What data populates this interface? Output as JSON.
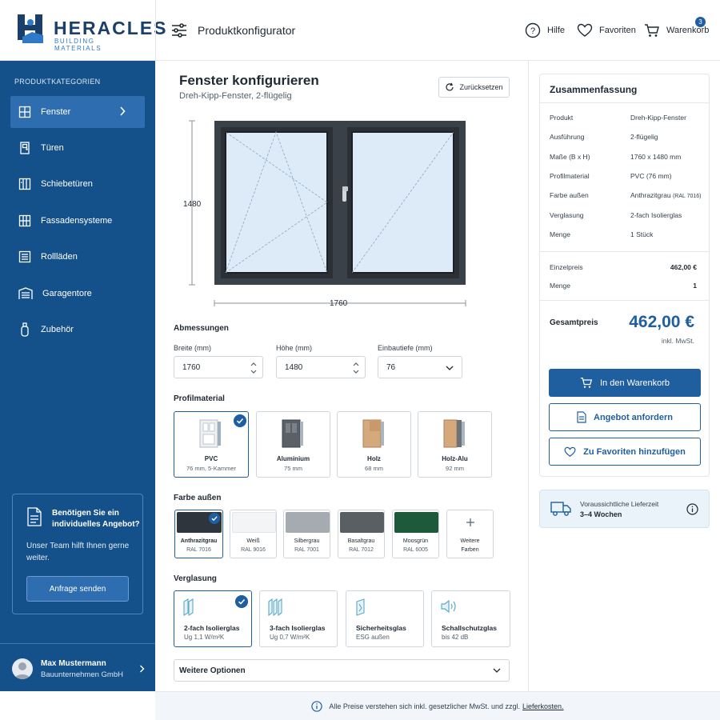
{
  "brand": {
    "name": "HERACLES",
    "tagline": "BUILDING MATERIALS",
    "accent": "#1f5fa0",
    "sidebar_bg": "#14508a"
  },
  "header": {
    "title": "Produktkonfigurator",
    "help": "Hilfe",
    "favorites": "Favoriten",
    "cart": "Warenkorb",
    "cart_count": "3"
  },
  "sidebar": {
    "heading": "PRODUKTKATEGORIEN",
    "items": [
      {
        "label": "Fenster",
        "icon": "window-icon",
        "active": true
      },
      {
        "label": "Türen",
        "icon": "door-icon"
      },
      {
        "label": "Schiebetüren",
        "icon": "sliding-door-icon"
      },
      {
        "label": "Fassadensysteme",
        "icon": "facade-icon"
      },
      {
        "label": "Rollläden",
        "icon": "shutter-icon"
      },
      {
        "label": "Garagentore",
        "icon": "garage-icon"
      },
      {
        "label": "Zubehör",
        "icon": "accessory-icon"
      }
    ],
    "help": {
      "title": "Benötigen Sie ein individuelles Angebot?",
      "text": "Unser Team hilft Ihnen gerne weiter.",
      "button": "Anfrage senden"
    },
    "user": {
      "name": "Max Mustermann",
      "company": "Bauunternehmen GmbH"
    }
  },
  "main": {
    "title": "Fenster konfigurieren",
    "subtitle": "Dreh-Kipp-Fenster, 2-flügelig",
    "reset": "Zurücksetzen",
    "preview": {
      "height_label": "1480",
      "width_label": "1760",
      "frame_color": "#3b4148",
      "glass_color": "#dcebf7"
    },
    "dimensions": {
      "title": "Abmessungen",
      "width_label": "Breite (mm)",
      "width_value": "1760",
      "height_label": "Höhe (mm)",
      "height_value": "1480",
      "depth_label": "Einbautiefe (mm)",
      "depth_value": "76"
    },
    "profile": {
      "title": "Profilmaterial",
      "options": [
        {
          "name": "PVC",
          "detail": "76 mm, 5-Kammer",
          "selected": true
        },
        {
          "name": "Aluminium",
          "detail": "75 mm"
        },
        {
          "name": "Holz",
          "detail": "68 mm"
        },
        {
          "name": "Holz-Alu",
          "detail": "92 mm"
        }
      ]
    },
    "color": {
      "title": "Farbe außen",
      "options": [
        {
          "name": "Anthrazitgrau",
          "code": "RAL 7016",
          "hex": "#2e353d",
          "selected": true
        },
        {
          "name": "Weiß",
          "code": "RAL 9016",
          "hex": "#f3f4f5"
        },
        {
          "name": "Silbergrau",
          "code": "RAL 7001",
          "hex": "#a5abb1"
        },
        {
          "name": "Basaltgrau",
          "code": "RAL 7012",
          "hex": "#5a5f64"
        },
        {
          "name": "Moosgrün",
          "code": "RAL 6005",
          "hex": "#1d5a3c"
        }
      ],
      "more_line1": "Weitere",
      "more_line2": "Farben"
    },
    "glazing": {
      "title": "Verglasung",
      "options": [
        {
          "name": "2-fach Isolierglas",
          "detail": "Ug 1,1 W/m²K",
          "selected": true
        },
        {
          "name": "3-fach Isolierglas",
          "detail": "Ug 0,7 W/m²K"
        },
        {
          "name": "Sicherheitsglas",
          "detail": "ESG außen"
        },
        {
          "name": "Schallschutzglas",
          "detail": "bis 42 dB"
        }
      ]
    },
    "more_options": "Weitere Optionen"
  },
  "summary": {
    "title": "Zusammenfassung",
    "rows": [
      {
        "label": "Produkt",
        "value": "Dreh-Kipp-Fenster"
      },
      {
        "label": "Ausführung",
        "value": "2-flügelig"
      },
      {
        "label": "Maße (B x H)",
        "value": "1760 x 1480 mm"
      },
      {
        "label": "Profilmaterial",
        "value": "PVC (76 mm)"
      },
      {
        "label": "Farbe außen",
        "value": "Anthrazitgrau",
        "value_note": "(RAL 7016)"
      },
      {
        "label": "Verglasung",
        "value": "2-fach Isolierglas"
      },
      {
        "label": "Menge",
        "value": "1 Stück"
      }
    ],
    "unit_price_label": "Einzelpreis",
    "unit_price": "462,00 €",
    "qty_label": "Menge",
    "qty": "1",
    "total_label": "Gesamtpreis",
    "total": "462,00 €",
    "tax_note": "inkl. MwSt.",
    "add_to_cart": "In den Warenkorb",
    "request_quote": "Angebot anfordern",
    "add_favorites": "Zu Favoriten hinzufügen"
  },
  "delivery": {
    "label": "Voraussichtliche Lieferzeit",
    "value": "3–4 Wochen"
  },
  "footer": {
    "text": "Alle Preise verstehen sich inkl. gesetzlicher MwSt. und zzgl.",
    "link": "Lieferkosten."
  }
}
